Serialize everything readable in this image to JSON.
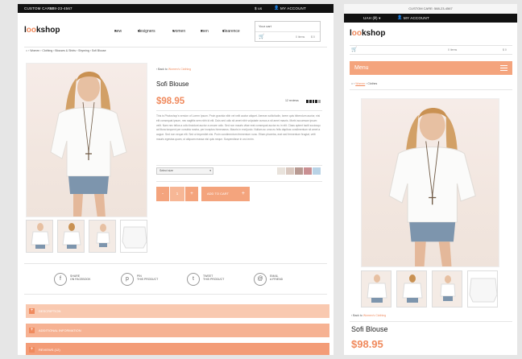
{
  "desktop": {
    "topbar": {
      "custom_care": "CUSTOM CARE:",
      "phone": "588-23-4567",
      "currency": "$ us",
      "account": "MY ACCOUNT"
    },
    "logo": {
      "pre": "l",
      "oo": "oo",
      "post": "kshop"
    },
    "nav": [
      "new",
      "designers",
      "women",
      "men",
      "clearence"
    ],
    "cart": {
      "title": "Your cart",
      "items": "0 items",
      "total": "$ 0"
    },
    "breadcrumb": [
      "Women",
      "Clothing",
      "Blouses & Shirts",
      "Shyming",
      "Sofi Blouse"
    ],
    "back_prefix": "Back to",
    "back_link": "Women's Clothing",
    "product": {
      "name": "Sofi Blouse",
      "price": "$98.95",
      "reviews": "12 reviews",
      "description": "This is Photoshop's version of Lorem Ipsum. Proin gravida nibh vel velit auctor aliquet. Aenean sollicitudin, lorem quis bibendum auctor, nisi elit consequat ipsum, nec sagittis sem nibh id elit. Duis sed odio sit amet nibh vulputate cursus a sit amet mauris. Morbi accumsan ipsum velit. Nam nec tellus a odio tincidunt auctor a ornare odio. Sed non mauris vitae erat consequat auctor eu in elit. Class aptent taciti sociosqu ad litora torquent per conubia nostra, per inceptos himenaeos. Mauris in erat justo. Nullam ac urna eu felis dapibus condimentum sit amet a augue. Sed non neque elit. Sed ut imperdiet nisi. Proin condimentum fermentum nunc. Etiam pharetra, erat sed fermentum feugiat, velit mauris egestas quam, ut aliquam massa nisl quis neque. Suspendisse in orci enim.",
      "size_placeholder": "Select size",
      "qty": "1",
      "minus": "-",
      "plus": "+",
      "add_to_cart": "ADD TO CART"
    },
    "swatches": [
      "#e9e3dc",
      "#d9c8bf",
      "#b89a92",
      "#c98f92",
      "#b9d3e6"
    ],
    "share": [
      {
        "icon": "f",
        "line1": "SHARE",
        "line2": "ON FACEBOOK"
      },
      {
        "icon": "p",
        "line1": "PIN",
        "line2": "THIS PRODUCT"
      },
      {
        "icon": "t",
        "line1": "TWEET",
        "line2": "THIS PRODUCT"
      },
      {
        "icon": "@",
        "line1": "EMAIL",
        "line2": "A FRIEND"
      }
    ],
    "accordion": [
      "DESCRIPTION",
      "ADDITIONAL INFORMATION",
      "REVIEWS (12)"
    ],
    "accordion_colors": [
      "#f9c9b0",
      "#f6b293",
      "#f39c77"
    ]
  },
  "mobile": {
    "custom_care": "CUSTOM CARE: 588-23-4567",
    "currency": "UAH (₴)",
    "account": "MY ACCOUNT",
    "cart_items": "0 items",
    "cart_total": "$ 0",
    "menu": "Menu",
    "breadcrumb": [
      "Women",
      "Clothes"
    ],
    "back_prefix": "Back to",
    "back_link": "Women's Clothing",
    "name": "Sofi Blouse",
    "price": "$98.95"
  },
  "colors": {
    "accent": "#f08a5d",
    "dark": "#111111"
  }
}
